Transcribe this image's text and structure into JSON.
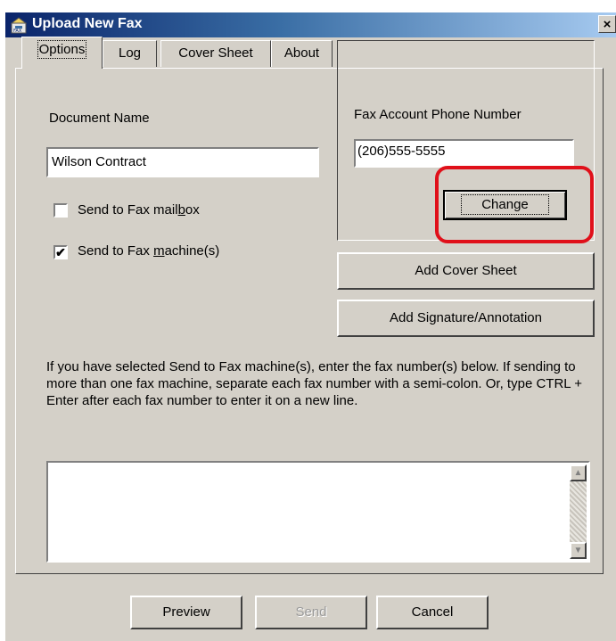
{
  "window": {
    "title": "Upload New Fax",
    "close_glyph": "×"
  },
  "tabs": [
    {
      "label": "Options",
      "active": true
    },
    {
      "label": "Log"
    },
    {
      "label": "Cover Sheet"
    },
    {
      "label": "About"
    }
  ],
  "document": {
    "label": "Document Name",
    "value": "Wilson Contract"
  },
  "fax_account": {
    "label": "Fax Account Phone Number",
    "value": "(206)555-5555",
    "change_label": "Change"
  },
  "checkboxes": {
    "mailbox": {
      "pre": "Send to Fax mail",
      "accel": "b",
      "post": "ox",
      "checked": false
    },
    "machine": {
      "pre": "Send to Fax ",
      "accel": "m",
      "post": "achine(s)",
      "checked": true
    }
  },
  "buttons": {
    "add_cover_sheet": "Add Cover Sheet",
    "add_signature": "Add Signature/Annotation",
    "preview": "Preview",
    "send": "Send",
    "cancel": "Cancel"
  },
  "instructions": "If you have selected Send to Fax machine(s), enter the fax number(s) below.  If sending to more than one fax machine, separate each fax number with a semi-colon.  Or, type CTRL + Enter after each fax number to enter it on a new line.",
  "fax_numbers": {
    "value": ""
  },
  "glyphs": {
    "check": "✔",
    "up": "▲",
    "down": "▼"
  },
  "colors": {
    "highlight": "#e0101a",
    "title_bar": "#0a246a"
  }
}
